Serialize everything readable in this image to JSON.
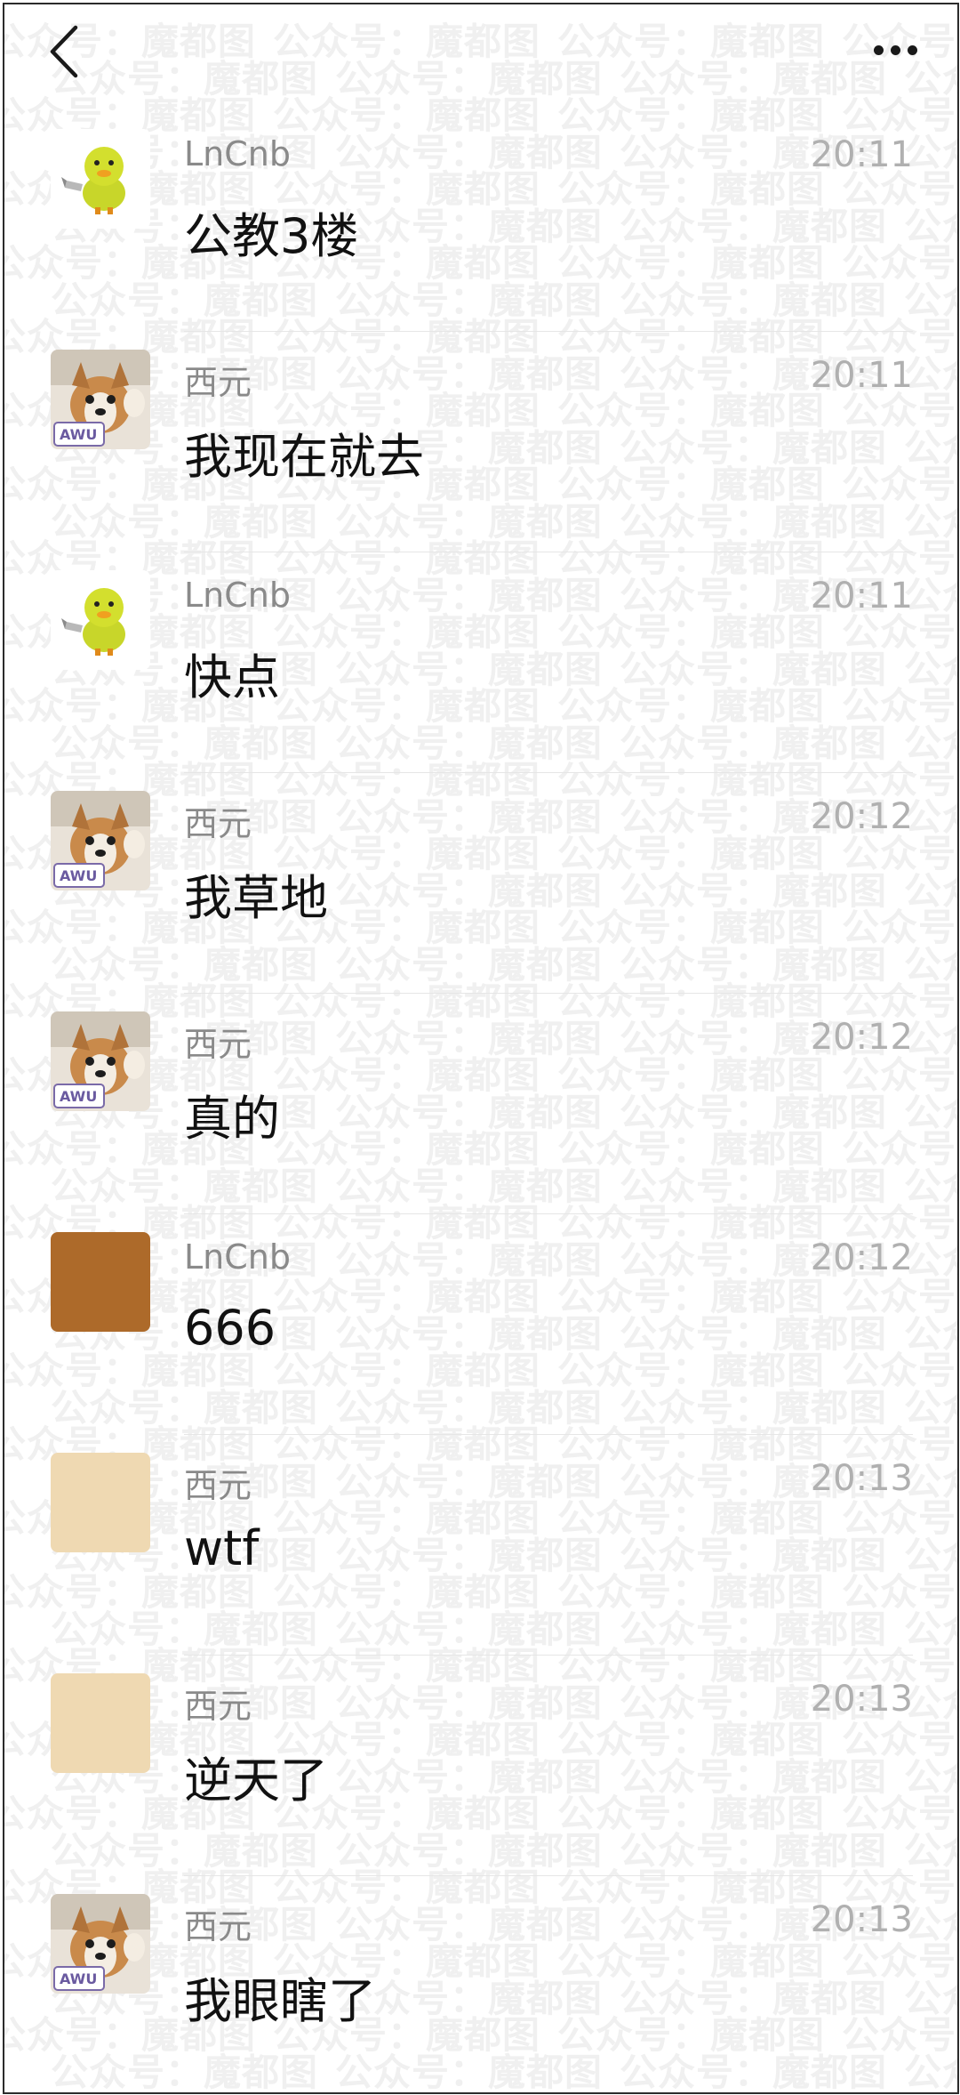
{
  "watermark": {
    "text": "公众号：魔都图"
  },
  "topbar": {
    "back_icon": "chevron-left-icon",
    "more_icon": "more-dots-icon"
  },
  "avatars": {
    "duck": "duck-avatar",
    "dog": "dog-avatar",
    "brown": {
      "color": "#ad6a2a"
    },
    "tan": {
      "color": "#efd9b2"
    }
  },
  "messages": [
    {
      "name": "LnCnb",
      "time": "20:11",
      "text": "公教3楼",
      "avatar": "duck"
    },
    {
      "name": "西元",
      "time": "20:11",
      "text": "我现在就去",
      "avatar": "dog"
    },
    {
      "name": "LnCnb",
      "time": "20:11",
      "text": "快点",
      "avatar": "duck"
    },
    {
      "name": "西元",
      "time": "20:12",
      "text": "我草地",
      "avatar": "dog"
    },
    {
      "name": "西元",
      "time": "20:12",
      "text": "真的",
      "avatar": "dog"
    },
    {
      "name": "LnCnb",
      "time": "20:12",
      "text": "666",
      "avatar": "brown"
    },
    {
      "name": "西元",
      "time": "20:13",
      "text": "wtf",
      "avatar": "tan"
    },
    {
      "name": "西元",
      "time": "20:13",
      "text": "逆天了",
      "avatar": "tan"
    },
    {
      "name": "西元",
      "time": "20:13",
      "text": "我眼瞎了",
      "avatar": "dog"
    }
  ]
}
